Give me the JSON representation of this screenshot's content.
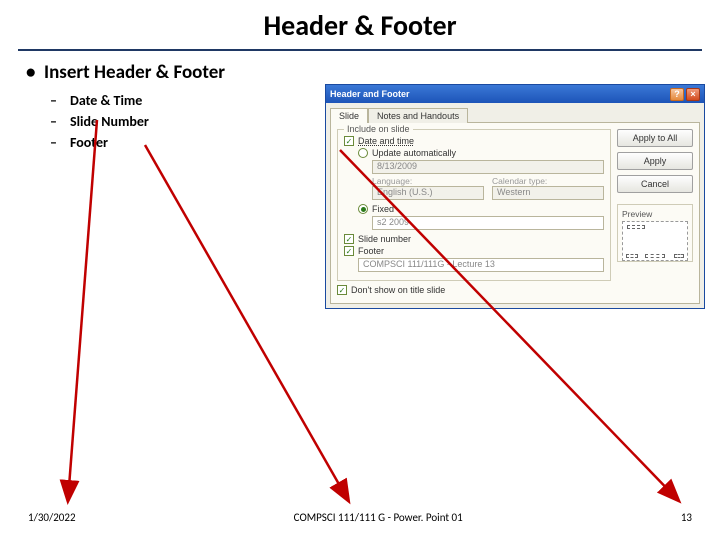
{
  "title": "Header & Footer",
  "bullets": {
    "main": "Insert Header & Footer",
    "subs": [
      "Date & Time",
      "Slide Number",
      "Footer"
    ]
  },
  "footer": {
    "date": "1/30/2022",
    "center": "COMPSCI 111/111 G - Power. Point 01",
    "page": "13"
  },
  "dialog": {
    "title": "Header and Footer",
    "tabs": {
      "slide": "Slide",
      "notes": "Notes and Handouts"
    },
    "groupTitle": "Include on slide",
    "dateTime": "Date and time",
    "updateAuto": "Update automatically",
    "dateValue": "8/13/2009",
    "langLabel": "Language:",
    "langValue": "English (U.S.)",
    "calLabel": "Calendar type:",
    "calValue": "Western",
    "fixed": "Fixed",
    "fixedValue": "s2 2009",
    "slideNumber": "Slide number",
    "footerLabel": "Footer",
    "footerValue": "COMPSCI 111/111G - Lecture 13",
    "dontShow": "Don't show on title slide",
    "buttons": {
      "applyAll": "Apply to All",
      "apply": "Apply",
      "cancel": "Cancel"
    },
    "previewLabel": "Preview"
  }
}
